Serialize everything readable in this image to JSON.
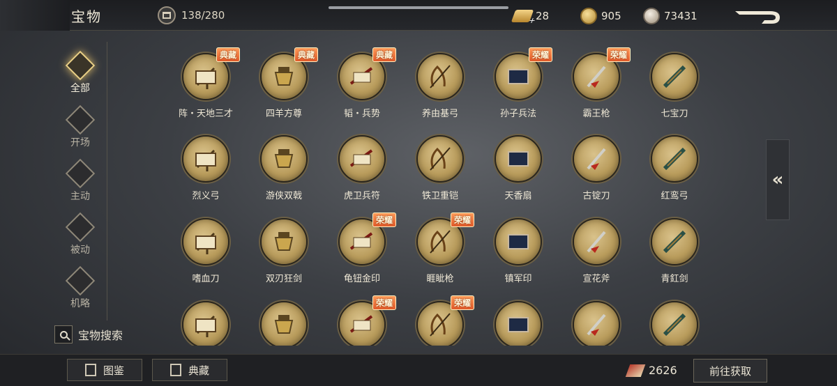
{
  "header": {
    "title": "宝物",
    "capacity": "138/280",
    "currencies": [
      {
        "icon": "gold-ingot-icon",
        "value": "28"
      },
      {
        "icon": "gold-coin-icon",
        "value": "905"
      },
      {
        "icon": "silver-coin-icon",
        "value": "73431"
      }
    ]
  },
  "sidebar": {
    "items": [
      {
        "label": "全部",
        "icon": "all-icon",
        "active": true
      },
      {
        "label": "开场",
        "icon": "opening-icon",
        "active": false
      },
      {
        "label": "主动",
        "icon": "active-icon",
        "active": false
      },
      {
        "label": "被动",
        "icon": "passive-icon",
        "active": false
      },
      {
        "label": "机略",
        "icon": "strategy-icon",
        "active": false
      }
    ],
    "search_label": "宝物搜索"
  },
  "treasures": [
    {
      "name": "阵・天地三才",
      "tag": "典藏"
    },
    {
      "name": "四羊方尊",
      "tag": "典藏"
    },
    {
      "name": "韬・兵势",
      "tag": "典藏"
    },
    {
      "name": "养由基弓",
      "tag": ""
    },
    {
      "name": "孙子兵法",
      "tag": "荣耀"
    },
    {
      "name": "霸王枪",
      "tag": "荣耀"
    },
    {
      "name": "七宝刀",
      "tag": ""
    },
    {
      "name": "烈义弓",
      "tag": ""
    },
    {
      "name": "游侠双戟",
      "tag": ""
    },
    {
      "name": "虎卫兵符",
      "tag": ""
    },
    {
      "name": "铁卫重铠",
      "tag": ""
    },
    {
      "name": "天香扇",
      "tag": ""
    },
    {
      "name": "古锭刀",
      "tag": ""
    },
    {
      "name": "红鸾弓",
      "tag": ""
    },
    {
      "name": "嗜血刀",
      "tag": ""
    },
    {
      "name": "双刃狂剑",
      "tag": ""
    },
    {
      "name": "龟钮金印",
      "tag": "荣耀"
    },
    {
      "name": "睚眦枪",
      "tag": "荣耀"
    },
    {
      "name": "镇军印",
      "tag": ""
    },
    {
      "name": "宣花斧",
      "tag": ""
    },
    {
      "name": "青釭剑",
      "tag": ""
    },
    {
      "name": "",
      "tag": ""
    },
    {
      "name": "",
      "tag": ""
    },
    {
      "name": "",
      "tag": "荣耀"
    },
    {
      "name": "",
      "tag": "荣耀"
    },
    {
      "name": "",
      "tag": ""
    },
    {
      "name": "",
      "tag": ""
    },
    {
      "name": "",
      "tag": ""
    }
  ],
  "footer": {
    "catalog_label": "图鉴",
    "collection_label": "典藏",
    "points": "2626",
    "go_label": "前往获取"
  }
}
